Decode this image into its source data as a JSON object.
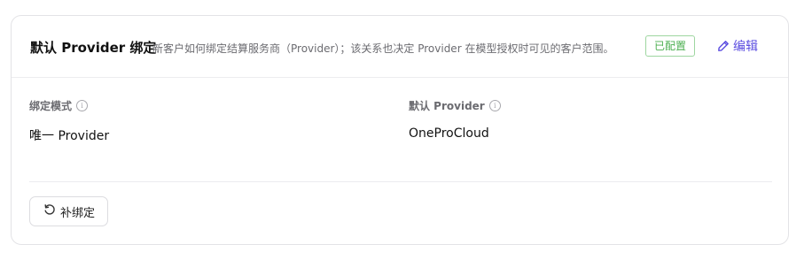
{
  "card": {
    "title": "默认 Provider 绑定",
    "description": "新客户如何绑定结算服务商（Provider）；该关系也决定 Provider 在模型授权时可见的客户范围。",
    "status_badge": "已配置",
    "edit_label": "编辑"
  },
  "fields": {
    "binding_mode": {
      "label": "绑定模式",
      "value": "唯一 Provider"
    },
    "default_provider": {
      "label": "默认 Provider",
      "value": "OneProCloud"
    }
  },
  "actions": {
    "rebind_label": "补绑定"
  },
  "colors": {
    "accent": "#5b4de0",
    "success": "#4caf50"
  },
  "icons": {
    "edit": "pencil-icon",
    "info": "info-icon",
    "rebind": "refresh-icon"
  }
}
